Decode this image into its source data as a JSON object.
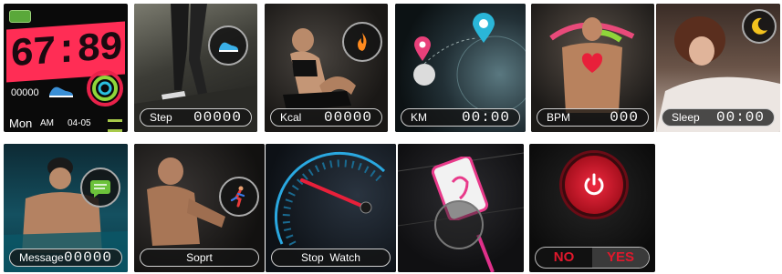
{
  "clock": {
    "time": "67:89",
    "steps": "00000",
    "day": "Mon",
    "ampm": "AM",
    "date": "04-05"
  },
  "tiles": {
    "step": {
      "label": "Step",
      "value": "00000"
    },
    "kcal": {
      "label": "Kcal",
      "value": "00000"
    },
    "km": {
      "label": "KM",
      "value": "00:00"
    },
    "bpm": {
      "label": "BPM",
      "value": "000"
    },
    "sleep": {
      "label": "Sleep",
      "value": "00:00"
    },
    "message": {
      "label": "Message",
      "value": "00000"
    },
    "sport": {
      "label": "Soprt"
    },
    "stopwatch": {
      "label": "Stop  Watch"
    },
    "power": {
      "no": "NO",
      "yes": "YES"
    }
  },
  "colors": {
    "clock_red": "#ff2d55",
    "accent_blue": "#2aa8e0",
    "power_red": "#e0182c"
  }
}
